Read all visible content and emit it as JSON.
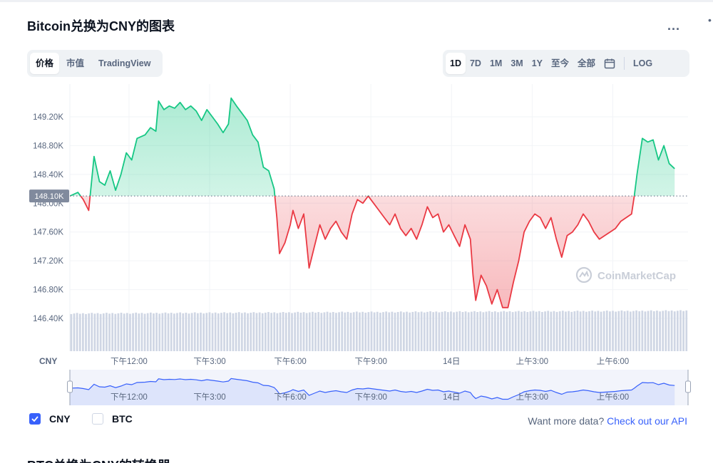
{
  "page": {
    "title": "Bitcoin兑换为CNY的图表",
    "more_label": "...",
    "edge_mark": "•",
    "bottom_title": "BTC兑换为CNY的转换器"
  },
  "metric_tabs": [
    {
      "label": "价格",
      "active": true
    },
    {
      "label": "市值",
      "active": false
    },
    {
      "label": "TradingView",
      "active": false
    }
  ],
  "range_tabs": [
    {
      "label": "1D",
      "active": true
    },
    {
      "label": "7D",
      "active": false
    },
    {
      "label": "1M",
      "active": false
    },
    {
      "label": "3M",
      "active": false
    },
    {
      "label": "1Y",
      "active": false
    },
    {
      "label": "至今",
      "active": false
    },
    {
      "label": "全部",
      "active": false
    }
  ],
  "log_label": "LOG",
  "legend": {
    "cny_label": "CNY",
    "cny_checked": true,
    "btc_label": "BTC",
    "btc_checked": false
  },
  "api": {
    "prefix": "Want more data?",
    "link": "Check out our API"
  },
  "colors": {
    "up": "#16c784",
    "down": "#ea3943",
    "volume": "#cfd6e4",
    "navigator_fill": "#dde4fb",
    "navigator_line": "#3861fb",
    "accent": "#3861fb"
  },
  "chart_data": {
    "type": "line",
    "series_currency": "CNY",
    "baseline": 148100,
    "baseline_label": "148.10K",
    "ylim": [
      146050,
      149470
    ],
    "y_ticks": [
      146400,
      146800,
      147200,
      147600,
      148000,
      148400,
      148800,
      149200
    ],
    "y_tick_labels": [
      "146.40K",
      "146.80K",
      "147.20K",
      "147.60K",
      "148.00K",
      "148.40K",
      "148.80K",
      "149.20K"
    ],
    "y_axis_label": "CNY",
    "x_ticks": [
      {
        "label": "下午12:00",
        "t": 2.2
      },
      {
        "label": "下午3:00",
        "t": 5.2
      },
      {
        "label": "下午6:00",
        "t": 8.2
      },
      {
        "label": "下午9:00",
        "t": 11.2
      },
      {
        "label": "14日",
        "t": 14.2
      },
      {
        "label": "上午3:00",
        "t": 17.2
      },
      {
        "label": "上午6:00",
        "t": 20.2
      }
    ],
    "t_range": [
      0,
      23.0
    ],
    "price": [
      {
        "t": 0.0,
        "v": 148100
      },
      {
        "t": 0.3,
        "v": 148150
      },
      {
        "t": 0.5,
        "v": 148050
      },
      {
        "t": 0.7,
        "v": 147900
      },
      {
        "t": 0.9,
        "v": 148650
      },
      {
        "t": 1.1,
        "v": 148300
      },
      {
        "t": 1.3,
        "v": 148250
      },
      {
        "t": 1.5,
        "v": 148450
      },
      {
        "t": 1.7,
        "v": 148180
      },
      {
        "t": 1.9,
        "v": 148400
      },
      {
        "t": 2.1,
        "v": 148700
      },
      {
        "t": 2.3,
        "v": 148600
      },
      {
        "t": 2.5,
        "v": 148900
      },
      {
        "t": 2.8,
        "v": 148950
      },
      {
        "t": 3.0,
        "v": 149050
      },
      {
        "t": 3.2,
        "v": 149000
      },
      {
        "t": 3.3,
        "v": 149420
      },
      {
        "t": 3.5,
        "v": 149300
      },
      {
        "t": 3.7,
        "v": 149350
      },
      {
        "t": 3.9,
        "v": 149320
      },
      {
        "t": 4.1,
        "v": 149400
      },
      {
        "t": 4.3,
        "v": 149300
      },
      {
        "t": 4.5,
        "v": 149350
      },
      {
        "t": 4.7,
        "v": 149280
      },
      {
        "t": 4.9,
        "v": 149150
      },
      {
        "t": 5.1,
        "v": 149300
      },
      {
        "t": 5.3,
        "v": 149200
      },
      {
        "t": 5.5,
        "v": 149100
      },
      {
        "t": 5.7,
        "v": 148980
      },
      {
        "t": 5.9,
        "v": 149100
      },
      {
        "t": 6.0,
        "v": 149460
      },
      {
        "t": 6.2,
        "v": 149350
      },
      {
        "t": 6.4,
        "v": 149250
      },
      {
        "t": 6.6,
        "v": 149150
      },
      {
        "t": 6.8,
        "v": 148950
      },
      {
        "t": 7.0,
        "v": 148850
      },
      {
        "t": 7.2,
        "v": 148500
      },
      {
        "t": 7.4,
        "v": 148450
      },
      {
        "t": 7.6,
        "v": 148200
      },
      {
        "t": 7.7,
        "v": 147800
      },
      {
        "t": 7.8,
        "v": 147300
      },
      {
        "t": 8.0,
        "v": 147450
      },
      {
        "t": 8.2,
        "v": 147700
      },
      {
        "t": 8.3,
        "v": 147900
      },
      {
        "t": 8.5,
        "v": 147650
      },
      {
        "t": 8.7,
        "v": 147850
      },
      {
        "t": 8.9,
        "v": 147100
      },
      {
        "t": 9.1,
        "v": 147400
      },
      {
        "t": 9.3,
        "v": 147700
      },
      {
        "t": 9.5,
        "v": 147500
      },
      {
        "t": 9.7,
        "v": 147650
      },
      {
        "t": 9.9,
        "v": 147750
      },
      {
        "t": 10.1,
        "v": 147600
      },
      {
        "t": 10.3,
        "v": 147500
      },
      {
        "t": 10.5,
        "v": 147850
      },
      {
        "t": 10.7,
        "v": 148050
      },
      {
        "t": 10.9,
        "v": 148000
      },
      {
        "t": 11.1,
        "v": 148100
      },
      {
        "t": 11.3,
        "v": 148000
      },
      {
        "t": 11.5,
        "v": 147900
      },
      {
        "t": 11.7,
        "v": 147800
      },
      {
        "t": 11.9,
        "v": 147700
      },
      {
        "t": 12.1,
        "v": 147850
      },
      {
        "t": 12.3,
        "v": 147650
      },
      {
        "t": 12.5,
        "v": 147550
      },
      {
        "t": 12.7,
        "v": 147650
      },
      {
        "t": 12.9,
        "v": 147500
      },
      {
        "t": 13.1,
        "v": 147700
      },
      {
        "t": 13.3,
        "v": 147950
      },
      {
        "t": 13.5,
        "v": 147800
      },
      {
        "t": 13.7,
        "v": 147850
      },
      {
        "t": 13.9,
        "v": 147600
      },
      {
        "t": 14.1,
        "v": 147700
      },
      {
        "t": 14.3,
        "v": 147550
      },
      {
        "t": 14.5,
        "v": 147400
      },
      {
        "t": 14.7,
        "v": 147700
      },
      {
        "t": 14.9,
        "v": 147500
      },
      {
        "t": 15.0,
        "v": 147000
      },
      {
        "t": 15.1,
        "v": 146650
      },
      {
        "t": 15.3,
        "v": 147000
      },
      {
        "t": 15.5,
        "v": 146850
      },
      {
        "t": 15.7,
        "v": 146600
      },
      {
        "t": 15.9,
        "v": 146800
      },
      {
        "t": 16.1,
        "v": 146550
      },
      {
        "t": 16.3,
        "v": 146550
      },
      {
        "t": 16.5,
        "v": 146900
      },
      {
        "t": 16.7,
        "v": 147200
      },
      {
        "t": 16.9,
        "v": 147600
      },
      {
        "t": 17.1,
        "v": 147750
      },
      {
        "t": 17.3,
        "v": 147850
      },
      {
        "t": 17.5,
        "v": 147800
      },
      {
        "t": 17.7,
        "v": 147650
      },
      {
        "t": 17.9,
        "v": 147800
      },
      {
        "t": 18.1,
        "v": 147500
      },
      {
        "t": 18.3,
        "v": 147250
      },
      {
        "t": 18.5,
        "v": 147550
      },
      {
        "t": 18.7,
        "v": 147600
      },
      {
        "t": 18.9,
        "v": 147700
      },
      {
        "t": 19.1,
        "v": 147850
      },
      {
        "t": 19.3,
        "v": 147750
      },
      {
        "t": 19.5,
        "v": 147600
      },
      {
        "t": 19.7,
        "v": 147500
      },
      {
        "t": 19.9,
        "v": 147550
      },
      {
        "t": 20.1,
        "v": 147600
      },
      {
        "t": 20.3,
        "v": 147650
      },
      {
        "t": 20.5,
        "v": 147750
      },
      {
        "t": 20.7,
        "v": 147800
      },
      {
        "t": 20.9,
        "v": 147850
      },
      {
        "t": 21.0,
        "v": 148100
      },
      {
        "t": 21.1,
        "v": 148400
      },
      {
        "t": 21.3,
        "v": 148900
      },
      {
        "t": 21.5,
        "v": 148850
      },
      {
        "t": 21.7,
        "v": 148880
      },
      {
        "t": 21.9,
        "v": 148600
      },
      {
        "t": 22.1,
        "v": 148800
      },
      {
        "t": 22.3,
        "v": 148550
      },
      {
        "t": 22.5,
        "v": 148480
      }
    ],
    "volume_relative": [
      0.72,
      0.72,
      0.73,
      0.73,
      0.74,
      0.74,
      0.75,
      0.75,
      0.76,
      0.76,
      0.77,
      0.77,
      0.78,
      0.78,
      0.79,
      0.79,
      0.8,
      0.8,
      0.8,
      0.81,
      0.81,
      0.82,
      0.83,
      0.83,
      0.84,
      0.84,
      0.85,
      0.85,
      0.86,
      0.86,
      0.86,
      0.87,
      0.87,
      0.88,
      0.88,
      0.89,
      0.89,
      0.9,
      0.9,
      0.9,
      0.91,
      0.91,
      0.92,
      0.92,
      0.93,
      0.93,
      0.93,
      0.94,
      0.94,
      0.95,
      0.95,
      0.96,
      0.96,
      0.97,
      0.97,
      0.98,
      0.98,
      0.99,
      0.99,
      1.0
    ]
  }
}
